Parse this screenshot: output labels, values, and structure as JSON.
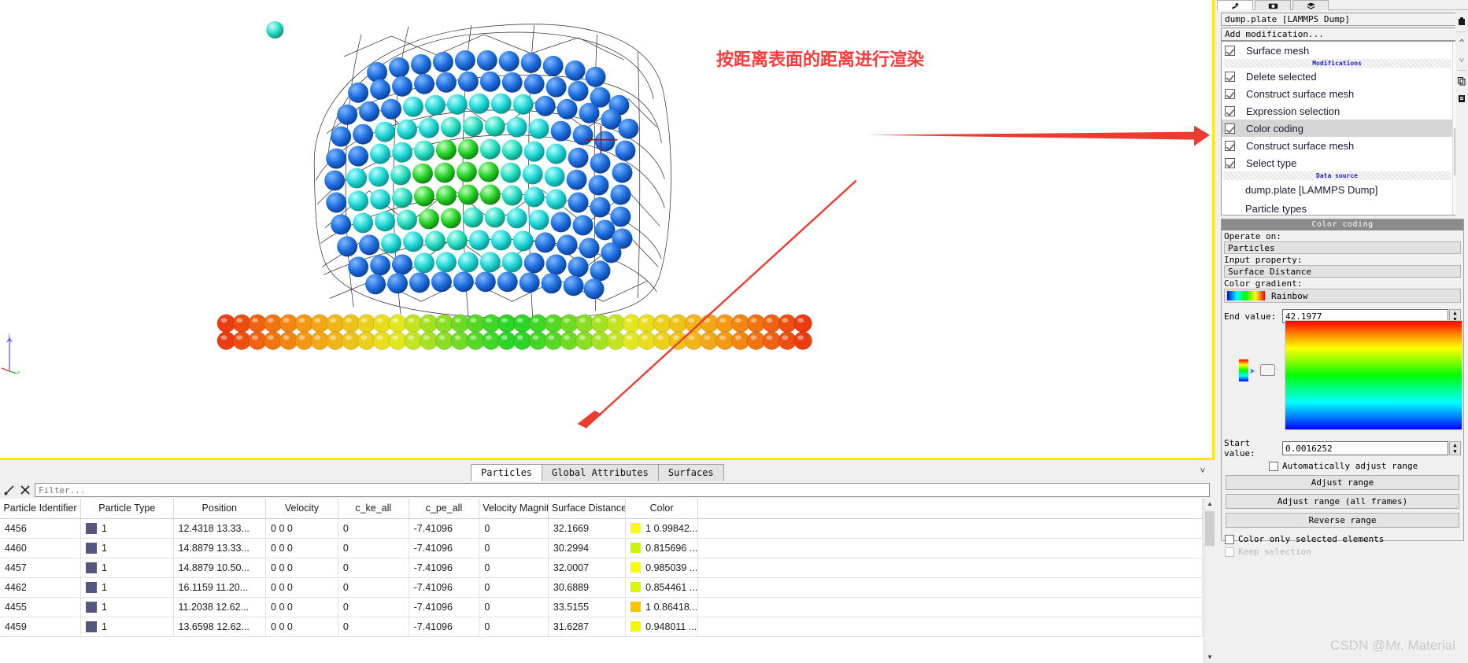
{
  "annotation": {
    "render_note": "按距离表面的距离进行渲染"
  },
  "watermark": "CSDN @Mr. Material",
  "right_panel": {
    "tabs": [
      {
        "name": "pipeline-tab",
        "icon": "wrench-icon"
      },
      {
        "name": "render-tab",
        "icon": "camera-icon"
      },
      {
        "name": "overlays-tab",
        "icon": "layers-icon"
      }
    ],
    "data_source_combo": "dump.plate [LAMMPS Dump]",
    "add_modification_combo": "Add modification...",
    "pipeline": [
      {
        "label": "Surface mesh",
        "checked": true,
        "selected": false,
        "type": "item"
      },
      {
        "label": "Modifications",
        "type": "separator"
      },
      {
        "label": "Delete selected",
        "checked": true,
        "selected": false,
        "type": "item"
      },
      {
        "label": "Construct surface mesh",
        "checked": true,
        "selected": false,
        "type": "item"
      },
      {
        "label": "Expression selection",
        "checked": true,
        "selected": false,
        "type": "item"
      },
      {
        "label": "Color coding",
        "checked": true,
        "selected": true,
        "type": "item"
      },
      {
        "label": "Construct surface mesh",
        "checked": true,
        "selected": false,
        "type": "item"
      },
      {
        "label": "Select type",
        "checked": true,
        "selected": false,
        "type": "item"
      },
      {
        "label": "Data source",
        "type": "separator"
      },
      {
        "label": "dump.plate [LAMMPS Dump]",
        "type": "sub"
      },
      {
        "label": "Particle types",
        "type": "sub"
      }
    ],
    "color_coding": {
      "title": "Color coding",
      "operate_on_label": "Operate on:",
      "operate_on_value": "Particles",
      "input_property_label": "Input property:",
      "input_property_value": "Surface Distance",
      "color_gradient_label": "Color gradient:",
      "color_gradient_value": "Rainbow",
      "end_value_label": "End value:",
      "end_value": "42.1977",
      "start_value_label": "Start value:",
      "start_value": "0.0016252",
      "auto_adjust_label": "Automatically adjust range",
      "auto_adjust_checked": false,
      "buttons": [
        "Adjust range",
        "Adjust range (all frames)",
        "Reverse range"
      ],
      "color_only_selected_label": "Color only selected elements",
      "color_only_selected_checked": false,
      "keep_selection_label": "Keep selection",
      "keep_selection_checked": false,
      "keep_selection_enabled": false
    }
  },
  "data_panel": {
    "tabs": [
      {
        "label": "Particles",
        "active": true
      },
      {
        "label": "Global Attributes",
        "active": false
      },
      {
        "label": "Surfaces",
        "active": false
      }
    ],
    "filter_placeholder": "Filter...",
    "columns": [
      "Particle Identifier",
      "Particle Type",
      "Position",
      "Velocity",
      "c_ke_all",
      "c_pe_all",
      "Velocity Magnitude",
      "Surface Distance",
      "Color"
    ],
    "rows": [
      {
        "id": "4456",
        "type": "1",
        "position": "12.4318 13.33...",
        "velocity": "0 0 0",
        "c_ke_all": "0",
        "c_pe_all": "-7.41096",
        "vmag": "0",
        "surface_distance": "32.1669",
        "color_text": "1 0.99842...",
        "color_hex": "#ffff00"
      },
      {
        "id": "4460",
        "type": "1",
        "position": "14.8879 13.33...",
        "velocity": "0 0 0",
        "c_ke_all": "0",
        "c_pe_all": "-7.41096",
        "vmag": "0",
        "surface_distance": "30.2994",
        "color_text": "0.815696 ...",
        "color_hex": "#ccf400"
      },
      {
        "id": "4457",
        "type": "1",
        "position": "14.8879 10.50...",
        "velocity": "0 0 0",
        "c_ke_all": "0",
        "c_pe_all": "-7.41096",
        "vmag": "0",
        "surface_distance": "32.0007",
        "color_text": "0.985039 ...",
        "color_hex": "#fbfb00"
      },
      {
        "id": "4462",
        "type": "1",
        "position": "16.1159 11.20...",
        "velocity": "0 0 0",
        "c_ke_all": "0",
        "c_pe_all": "-7.41096",
        "vmag": "0",
        "surface_distance": "30.6889",
        "color_text": "0.854461 ...",
        "color_hex": "#d9f500"
      },
      {
        "id": "4455",
        "type": "1",
        "position": "11.2038 12.62...",
        "velocity": "0 0 0",
        "c_ke_all": "0",
        "c_pe_all": "-7.41096",
        "vmag": "0",
        "surface_distance": "33.5155",
        "color_text": "1 0.86418...",
        "color_hex": "#ffc400"
      },
      {
        "id": "4459",
        "type": "1",
        "position": "13.6598 12.62...",
        "velocity": "0 0 0",
        "c_ke_all": "0",
        "c_pe_all": "-7.41096",
        "vmag": "0",
        "surface_distance": "31.6287",
        "color_text": "0.948011 ...",
        "color_hex": "#f7f700"
      }
    ]
  }
}
